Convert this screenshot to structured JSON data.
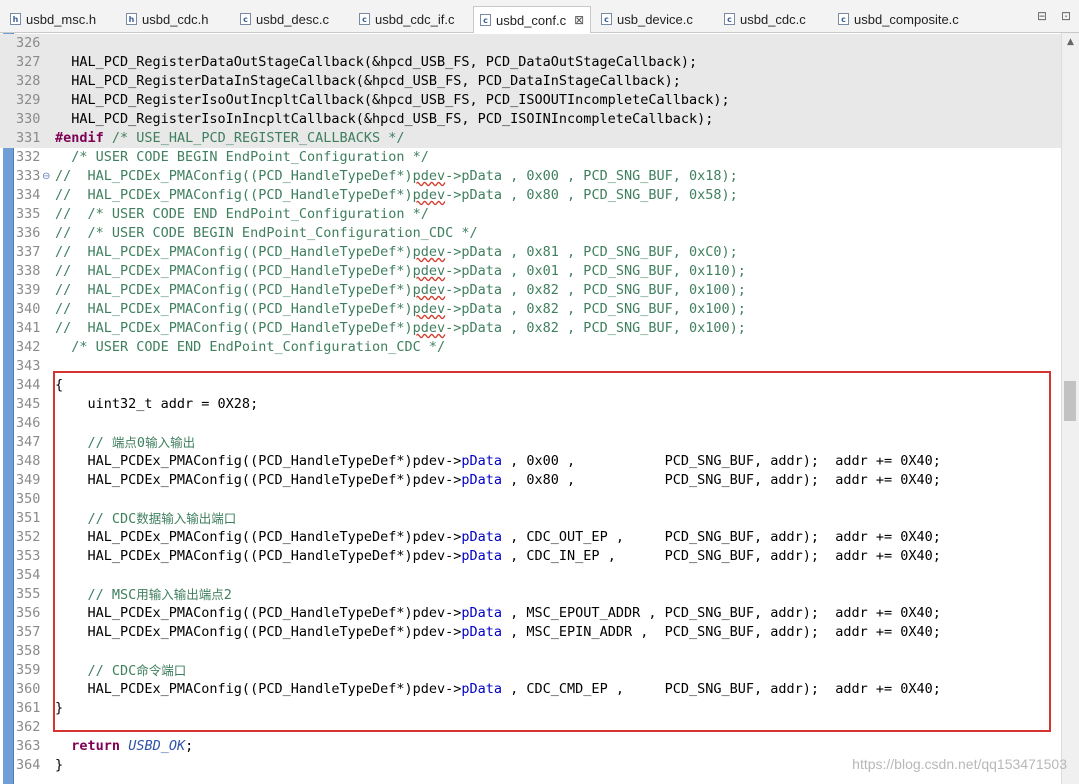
{
  "tabs": [
    {
      "name": "usbd_msc.h",
      "icon": "h"
    },
    {
      "name": "usbd_cdc.h",
      "icon": "h"
    },
    {
      "name": "usbd_desc.c",
      "icon": "c"
    },
    {
      "name": "usbd_cdc_if.c",
      "icon": "c"
    },
    {
      "name": "usbd_conf.c",
      "icon": "c",
      "active": true
    },
    {
      "name": "usb_device.c",
      "icon": "c"
    },
    {
      "name": "usbd_cdc.c",
      "icon": "c"
    },
    {
      "name": "usbd_composite.c",
      "icon": "c"
    }
  ],
  "tab_close_glyph": "⊠",
  "tab_menu_glyphs": [
    "⊟",
    "⊡"
  ],
  "lines": [
    {
      "n": "326",
      "code": ""
    },
    {
      "n": "327",
      "code": "  HAL_PCD_RegisterDataOutStageCallback(&hpcd_USB_FS, PCD_DataOutStageCallback);"
    },
    {
      "n": "328",
      "code": "  HAL_PCD_RegisterDataInStageCallback(&hpcd_USB_FS, PCD_DataInStageCallback);"
    },
    {
      "n": "329",
      "code": "  HAL_PCD_RegisterIsoOutIncpltCallback(&hpcd_USB_FS, PCD_ISOOUTIncompleteCallback);"
    },
    {
      "n": "330",
      "code": "  HAL_PCD_RegisterIsoInIncpltCallback(&hpcd_USB_FS, PCD_ISOINIncompleteCallback);"
    },
    {
      "n": "331",
      "code": "#endif /* USE_HAL_PCD_REGISTER_CALLBACKS */"
    },
    {
      "n": "332",
      "code": "  /* USER CODE BEGIN EndPoint_Configuration */"
    },
    {
      "n": "333",
      "code": "//  HAL_PCDEx_PMAConfig((PCD_HandleTypeDef*)pdev->pData , 0x00 , PCD_SNG_BUF, 0x18);"
    },
    {
      "n": "334",
      "code": "//  HAL_PCDEx_PMAConfig((PCD_HandleTypeDef*)pdev->pData , 0x80 , PCD_SNG_BUF, 0x58);"
    },
    {
      "n": "335",
      "code": "//  /* USER CODE END EndPoint_Configuration */"
    },
    {
      "n": "336",
      "code": "//  /* USER CODE BEGIN EndPoint_Configuration_CDC */"
    },
    {
      "n": "337",
      "code": "//  HAL_PCDEx_PMAConfig((PCD_HandleTypeDef*)pdev->pData , 0x81 , PCD_SNG_BUF, 0xC0);"
    },
    {
      "n": "338",
      "code": "//  HAL_PCDEx_PMAConfig((PCD_HandleTypeDef*)pdev->pData , 0x01 , PCD_SNG_BUF, 0x110);"
    },
    {
      "n": "339",
      "code": "//  HAL_PCDEx_PMAConfig((PCD_HandleTypeDef*)pdev->pData , 0x82 , PCD_SNG_BUF, 0x100);"
    },
    {
      "n": "340",
      "code": "//  HAL_PCDEx_PMAConfig((PCD_HandleTypeDef*)pdev->pData , 0x82 , PCD_SNG_BUF, 0x100);"
    },
    {
      "n": "341",
      "code": "//  HAL_PCDEx_PMAConfig((PCD_HandleTypeDef*)pdev->pData , 0x82 , PCD_SNG_BUF, 0x100);"
    },
    {
      "n": "342",
      "code": "  /* USER CODE END EndPoint_Configuration_CDC */"
    },
    {
      "n": "343",
      "code": ""
    },
    {
      "n": "344",
      "code": "{"
    },
    {
      "n": "345",
      "code": "    uint32_t addr = 0X28;"
    },
    {
      "n": "346",
      "code": ""
    },
    {
      "n": "347",
      "code": "    // 端点0输入输出"
    },
    {
      "n": "348",
      "code": "    HAL_PCDEx_PMAConfig((PCD_HandleTypeDef*)pdev->pData , 0x00 ,           PCD_SNG_BUF, addr);  addr += 0X40;"
    },
    {
      "n": "349",
      "code": "    HAL_PCDEx_PMAConfig((PCD_HandleTypeDef*)pdev->pData , 0x80 ,           PCD_SNG_BUF, addr);  addr += 0X40;"
    },
    {
      "n": "350",
      "code": ""
    },
    {
      "n": "351",
      "code": "    // CDC数据输入输出端口"
    },
    {
      "n": "352",
      "code": "    HAL_PCDEx_PMAConfig((PCD_HandleTypeDef*)pdev->pData , CDC_OUT_EP ,     PCD_SNG_BUF, addr);  addr += 0X40;"
    },
    {
      "n": "353",
      "code": "    HAL_PCDEx_PMAConfig((PCD_HandleTypeDef*)pdev->pData , CDC_IN_EP ,      PCD_SNG_BUF, addr);  addr += 0X40;"
    },
    {
      "n": "354",
      "code": ""
    },
    {
      "n": "355",
      "code": "    // MSC用输入输出端点2"
    },
    {
      "n": "356",
      "code": "    HAL_PCDEx_PMAConfig((PCD_HandleTypeDef*)pdev->pData , MSC_EPOUT_ADDR , PCD_SNG_BUF, addr);  addr += 0X40;"
    },
    {
      "n": "357",
      "code": "    HAL_PCDEx_PMAConfig((PCD_HandleTypeDef*)pdev->pData , MSC_EPIN_ADDR ,  PCD_SNG_BUF, addr);  addr += 0X40;"
    },
    {
      "n": "358",
      "code": ""
    },
    {
      "n": "359",
      "code": "    // CDC命令端口"
    },
    {
      "n": "360",
      "code": "    HAL_PCDEx_PMAConfig((PCD_HandleTypeDef*)pdev->pData , CDC_CMD_EP ,     PCD_SNG_BUF, addr);  addr += 0X40;"
    },
    {
      "n": "361",
      "code": "}"
    },
    {
      "n": "362",
      "code": ""
    },
    {
      "n": "363",
      "code": "  return USBD_OK;"
    },
    {
      "n": "364",
      "code": "}"
    }
  ],
  "fold_marker_line": "333",
  "fold_marker_glyph": "⊖",
  "scroll_up_glyph": "▲",
  "watermark": "https://blog.csdn.net/qq153471503",
  "colors": {
    "highlight_block_border": "#d63333",
    "comment": "#3f7f5f",
    "keyword": "#7f0055",
    "field": "#0000c0",
    "macro": "#2d52a8"
  }
}
